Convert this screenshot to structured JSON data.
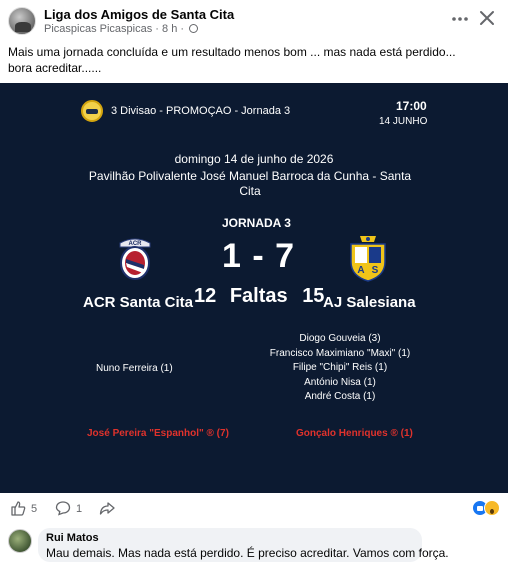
{
  "post": {
    "group_name": "Liga dos Amigos de Santa Cita",
    "author": "Picaspicas Picaspicas",
    "time": "8 h",
    "caption": "Mais uma jornada concluída e um resultado menos bom ... mas nada está perdido... bora acreditar......"
  },
  "poster": {
    "competition": "3 Divisao - PROMOÇAO - Jornada 3",
    "time": "17:00",
    "date_short": "14 JUNHO",
    "date_long": "domingo 14 de junho de 2026",
    "venue": "Pavilhão Polivalente José Manuel Barroca da Cunha - Santa Cita",
    "round": "JORNADA 3",
    "score": "1 - 7",
    "home_team": "ACR Santa Cita",
    "away_team": "AJ Salesiana",
    "home_crest_text": "ACR",
    "fouls_home": "12",
    "fouls_label": "Faltas",
    "fouls_away": "15",
    "home_scorers": [
      "Nuno Ferreira (1)"
    ],
    "away_scorers": [
      "Diogo Gouveia (3)",
      "Francisco Maximiano \"Maxi\" (1)",
      "Filipe \"Chipi\" Reis (1)",
      "António Nisa (1)",
      "André Costa (1)"
    ],
    "home_red_card": "José Pereira \"Espanhol\" ® (7)",
    "away_red_card": "Gonçalo Henriques ® (1)",
    "colors": {
      "background": "#0c1a31",
      "red": "#e0322c",
      "text": "#ffffff"
    }
  },
  "reactions": {
    "like_count": "5",
    "comment_count": "1"
  },
  "comment": {
    "author": "Rui Matos",
    "text": "Mau demais. Mas nada está perdido. É preciso acreditar. Vamos com força."
  }
}
